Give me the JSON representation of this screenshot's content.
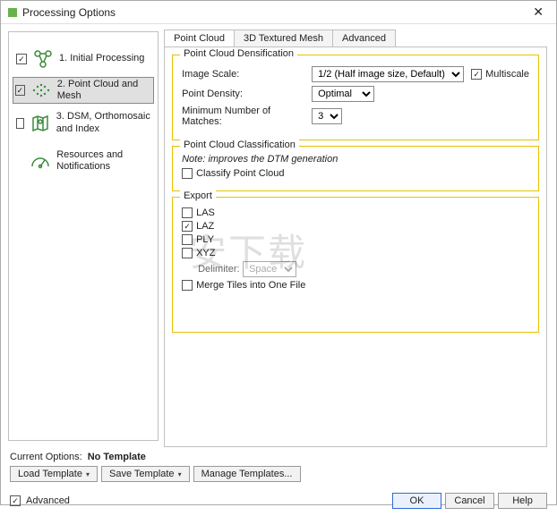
{
  "title": "Processing Options",
  "sidebar": {
    "steps": [
      {
        "label": "1. Initial Processing",
        "checked": true,
        "selected": false
      },
      {
        "label": "2. Point Cloud and Mesh",
        "checked": true,
        "selected": true
      },
      {
        "label": "3. DSM, Orthomosaic and Index",
        "checked": false,
        "selected": false
      },
      {
        "label": "Resources and Notifications",
        "checked": null,
        "selected": false
      }
    ]
  },
  "tabs": [
    "Point Cloud",
    "3D Textured Mesh",
    "Advanced"
  ],
  "group_dens": {
    "legend": "Point Cloud Densification",
    "image_scale_label": "Image Scale:",
    "image_scale_value": "1/2 (Half image size, Default)",
    "multiscale_label": "Multiscale",
    "multiscale_checked": true,
    "density_label": "Point Density:",
    "density_value": "Optimal",
    "matches_label": "Minimum Number of Matches:",
    "matches_value": "3"
  },
  "group_class": {
    "legend": "Point Cloud Classification",
    "note": "Note: improves the DTM generation",
    "classify_label": "Classify Point Cloud",
    "classify_checked": false
  },
  "group_export": {
    "legend": "Export",
    "items": [
      {
        "label": "LAS",
        "checked": false
      },
      {
        "label": "LAZ",
        "checked": true
      },
      {
        "label": "PLY",
        "checked": false
      },
      {
        "label": "XYZ",
        "checked": false
      }
    ],
    "delimiter_label": "Delimiter:",
    "delimiter_value": "Space",
    "merge_label": "Merge Tiles into One File",
    "merge_checked": false
  },
  "footer": {
    "current_options": "Current Options:",
    "no_template": "No Template",
    "load": "Load Template",
    "save": "Save Template",
    "manage": "Manage Templates..."
  },
  "bottom": {
    "advanced": "Advanced",
    "advanced_checked": true,
    "ok": "OK",
    "cancel": "Cancel",
    "help": "Help"
  }
}
